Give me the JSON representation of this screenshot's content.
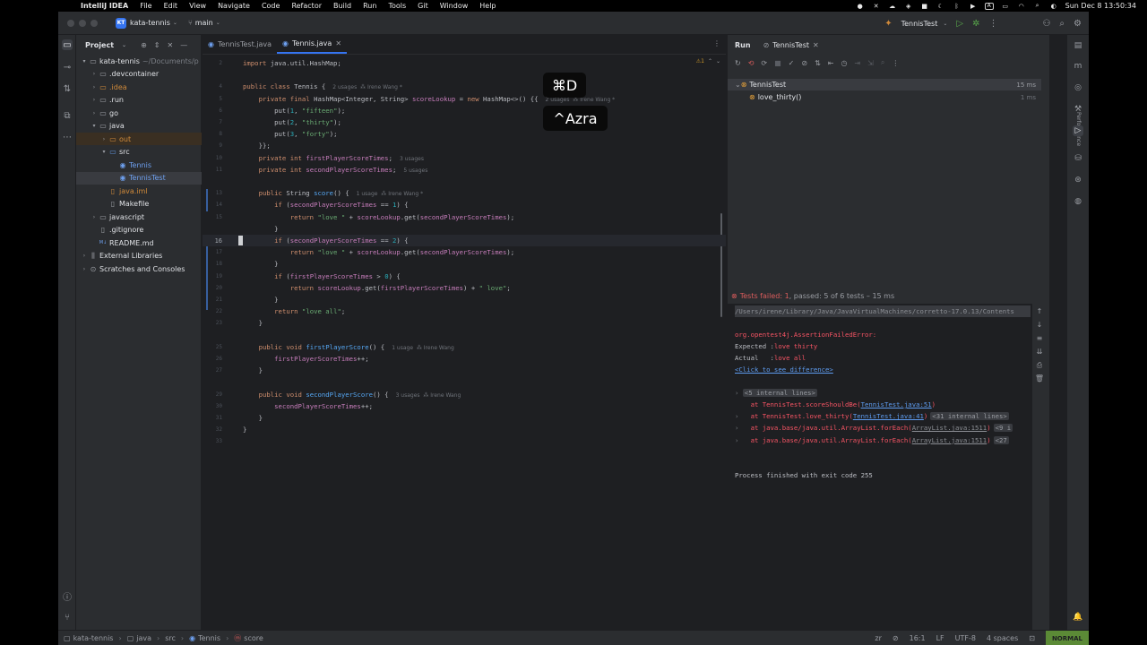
{
  "menubar": {
    "app": "IntelliJ IDEA",
    "items": [
      "File",
      "Edit",
      "View",
      "Navigate",
      "Code",
      "Refactor",
      "Build",
      "Run",
      "Tools",
      "Git",
      "Window",
      "Help"
    ],
    "clock": "Sun Dec 8  13:50:34"
  },
  "titlebar": {
    "project_badge": "KT",
    "project": "kata-tennis",
    "branch": "main",
    "run_config": "TennisTest"
  },
  "project_panel": {
    "title": "Project",
    "tree": [
      {
        "label": "kata-tennis",
        "sub": "~/Documents/p",
        "indent": 0,
        "arrow": "▾",
        "type": "folder"
      },
      {
        "label": ".devcontainer",
        "indent": 1,
        "arrow": "›",
        "type": "folder"
      },
      {
        "label": ".idea",
        "indent": 1,
        "arrow": "›",
        "type": "folder",
        "color": "orange"
      },
      {
        "label": ".run",
        "indent": 1,
        "arrow": "›",
        "type": "folder"
      },
      {
        "label": "go",
        "indent": 1,
        "arrow": "›",
        "type": "folder"
      },
      {
        "label": "java",
        "indent": 1,
        "arrow": "▾",
        "type": "folder"
      },
      {
        "label": "out",
        "indent": 2,
        "arrow": "›",
        "type": "folder",
        "color": "orange",
        "highlight": true
      },
      {
        "label": "src",
        "indent": 2,
        "arrow": "▾",
        "type": "folder-blue"
      },
      {
        "label": "Tennis",
        "indent": 3,
        "arrow": "",
        "type": "class"
      },
      {
        "label": "TennisTest",
        "indent": 3,
        "arrow": "",
        "type": "class",
        "selected": true
      },
      {
        "label": "java.iml",
        "indent": 2,
        "arrow": "",
        "type": "file",
        "color": "orange"
      },
      {
        "label": "Makefile",
        "indent": 2,
        "arrow": "",
        "type": "file"
      },
      {
        "label": "javascript",
        "indent": 1,
        "arrow": "›",
        "type": "folder"
      },
      {
        "label": ".gitignore",
        "indent": 1,
        "arrow": "",
        "type": "file"
      },
      {
        "label": "README.md",
        "indent": 1,
        "arrow": "",
        "type": "md"
      },
      {
        "label": "External Libraries",
        "indent": 0,
        "arrow": "›",
        "type": "lib"
      },
      {
        "label": "Scratches and Consoles",
        "indent": 0,
        "arrow": "›",
        "type": "scratch"
      }
    ]
  },
  "editor": {
    "tabs": [
      {
        "label": "TennisTest.java",
        "active": false
      },
      {
        "label": "Tennis.java",
        "active": true
      }
    ],
    "problems_badge": "⚠1",
    "lines": [
      {
        "n": "2",
        "html": "<span class=\"kw\">import</span> java.util.HashMap;"
      },
      {
        "n": "",
        "html": ""
      },
      {
        "n": "4",
        "html": "<span class=\"kw\">public class</span> Tennis {<span class=\"hint\">2 usages  ⁂ Irene Wang *</span>"
      },
      {
        "n": "5",
        "html": "    <span class=\"kw\">private final</span> HashMap&lt;Integer, String&gt; <span class=\"fld\">scoreLookup</span> = <span class=\"kw\">new</span> HashMap&lt;&gt;() {{<span class=\"hint\">2 usages  ⁂ Irene Wang *</span>"
      },
      {
        "n": "6",
        "html": "        put(<span class=\"num\">1</span>, <span class=\"str\">\"fifteen\"</span>);"
      },
      {
        "n": "7",
        "html": "        put(<span class=\"num\">2</span>, <span class=\"str\">\"thirty\"</span>);"
      },
      {
        "n": "8",
        "html": "        put(<span class=\"num\">3</span>, <span class=\"str\">\"forty\"</span>);"
      },
      {
        "n": "9",
        "html": "    }};"
      },
      {
        "n": "10",
        "html": "    <span class=\"kw\">private int</span> <span class=\"fld\">firstPlayerScoreTimes</span>;<span class=\"hint\">3 usages</span>"
      },
      {
        "n": "11",
        "html": "    <span class=\"kw\">private int</span> <span class=\"fld\">secondPlayerScoreTimes</span>;<span class=\"hint\">5 usages</span>"
      },
      {
        "n": "",
        "html": ""
      },
      {
        "n": "13",
        "html": "    <span class=\"kw\">public</span> String <span class=\"fn\">score</span>() {<span class=\"hint\">1 usage  ⁂ Irene Wang *</span>"
      },
      {
        "n": "14",
        "html": "        <span class=\"kw\">if</span> (<span class=\"fld\">secondPlayerScoreTimes</span> == <span class=\"num\">1</span>) {"
      },
      {
        "n": "15",
        "html": "            <span class=\"kw\">return</span> <span class=\"str\">\"love \"</span> + <span class=\"fld\">scoreLookup</span>.get(<span class=\"fld\">secondPlayerScoreTimes</span>);"
      },
      {
        "n": "",
        "html": "        }"
      },
      {
        "n": "16",
        "html": "        <span class=\"kw\">if</span> (<span class=\"fld\">secondPlayerScoreTimes</span> == <span class=\"num\">2</span>) {"
      },
      {
        "n": "17",
        "html": "            <span class=\"kw\">return</span> <span class=\"str\">\"love \"</span> + <span class=\"fld\">scoreLookup</span>.get(<span class=\"fld\">secondPlayerScoreTimes</span>);"
      },
      {
        "n": "18",
        "html": "        }"
      },
      {
        "n": "19",
        "html": "        <span class=\"kw\">if</span> (<span class=\"fld\">firstPlayerScoreTimes</span> &gt; <span class=\"num\">0</span>) {"
      },
      {
        "n": "20",
        "html": "            <span class=\"kw\">return</span> <span class=\"fld\">scoreLookup</span>.get(<span class=\"fld\">firstPlayerScoreTimes</span>) + <span class=\"str\">\" love\"</span>;"
      },
      {
        "n": "21",
        "html": "        }"
      },
      {
        "n": "22",
        "html": "        <span class=\"kw\">return</span> <span class=\"str\">\"love all\"</span>;"
      },
      {
        "n": "23",
        "html": "    }"
      },
      {
        "n": "",
        "html": ""
      },
      {
        "n": "25",
        "html": "    <span class=\"kw\">public void</span> <span class=\"fn\">firstPlayerScore</span>() {<span class=\"hint\">1 usage  ⁂ Irene Wang</span>"
      },
      {
        "n": "26",
        "html": "        <span class=\"fld\">firstPlayerScoreTimes</span>++;"
      },
      {
        "n": "27",
        "html": "    }"
      },
      {
        "n": "",
        "html": ""
      },
      {
        "n": "29",
        "html": "    <span class=\"kw\">public void</span> <span class=\"fn\">secondPlayerScore</span>() {<span class=\"hint\">3 usages  ⁂ Irene Wang</span>"
      },
      {
        "n": "30",
        "html": "        <span class=\"fld\">secondPlayerScoreTimes</span>++;"
      },
      {
        "n": "31",
        "html": "    }"
      },
      {
        "n": "32",
        "html": "}"
      },
      {
        "n": "33",
        "html": ""
      }
    ],
    "current_line_label": "16"
  },
  "keytips": {
    "shortcut": "⌘D",
    "sequence": "^Azra"
  },
  "run_panel": {
    "title": "Run",
    "tab": "TennisTest",
    "tests": [
      {
        "label": "TennisTest",
        "time": "15 ms",
        "level": 0
      },
      {
        "label": "love_thirty()",
        "time": "1 ms",
        "level": 1
      }
    ],
    "status_fail": "Tests failed: 1",
    "status_rest": ", passed: 5 of 6 tests – 15 ms",
    "console": {
      "path": "/Users/irene/Library/Java/JavaVirtualMachines/corretto-17.0.13/Contents",
      "error": "org.opentest4j.AssertionFailedError:",
      "expected_label": "Expected :",
      "expected": "love thirty",
      "actual_label": "Actual   :",
      "actual": "love all",
      "diff_link": "<Click to see difference>",
      "internal": "<5 internal lines>",
      "stack": [
        {
          "pre": "at TennisTest.scoreShouldBe(",
          "link": "TennisTest.java:51",
          "post": ")",
          "pill": ""
        },
        {
          "pre": "at TennisTest.love_thirty(",
          "link": "TennisTest.java:41",
          "post": ")",
          "pill": "<31 internal lines>"
        },
        {
          "pre": "at java.base/java.util.ArrayList.forEach(",
          "link": "ArrayList.java:1511",
          "post": ")",
          "pill": "<9 i"
        },
        {
          "pre": "at java.base/java.util.ArrayList.forEach(",
          "link": "ArrayList.java:1511",
          "post": ")",
          "pill": "<27"
        }
      ],
      "finished": "Process finished with exit code 255"
    }
  },
  "right_strip": {
    "performance_label": "Performance"
  },
  "statusbar": {
    "crumbs": [
      "kata-tennis",
      "java",
      "src",
      "Tennis",
      "score"
    ],
    "caret_pos": "16:1",
    "line_sep": "LF",
    "encoding": "UTF-8",
    "indent": "4 spaces",
    "mode": "NORMAL"
  },
  "colors": {
    "accent": "#3574f0",
    "fail": "#db5c5c",
    "pass": "#57a64a",
    "warn": "#e8a33a"
  }
}
